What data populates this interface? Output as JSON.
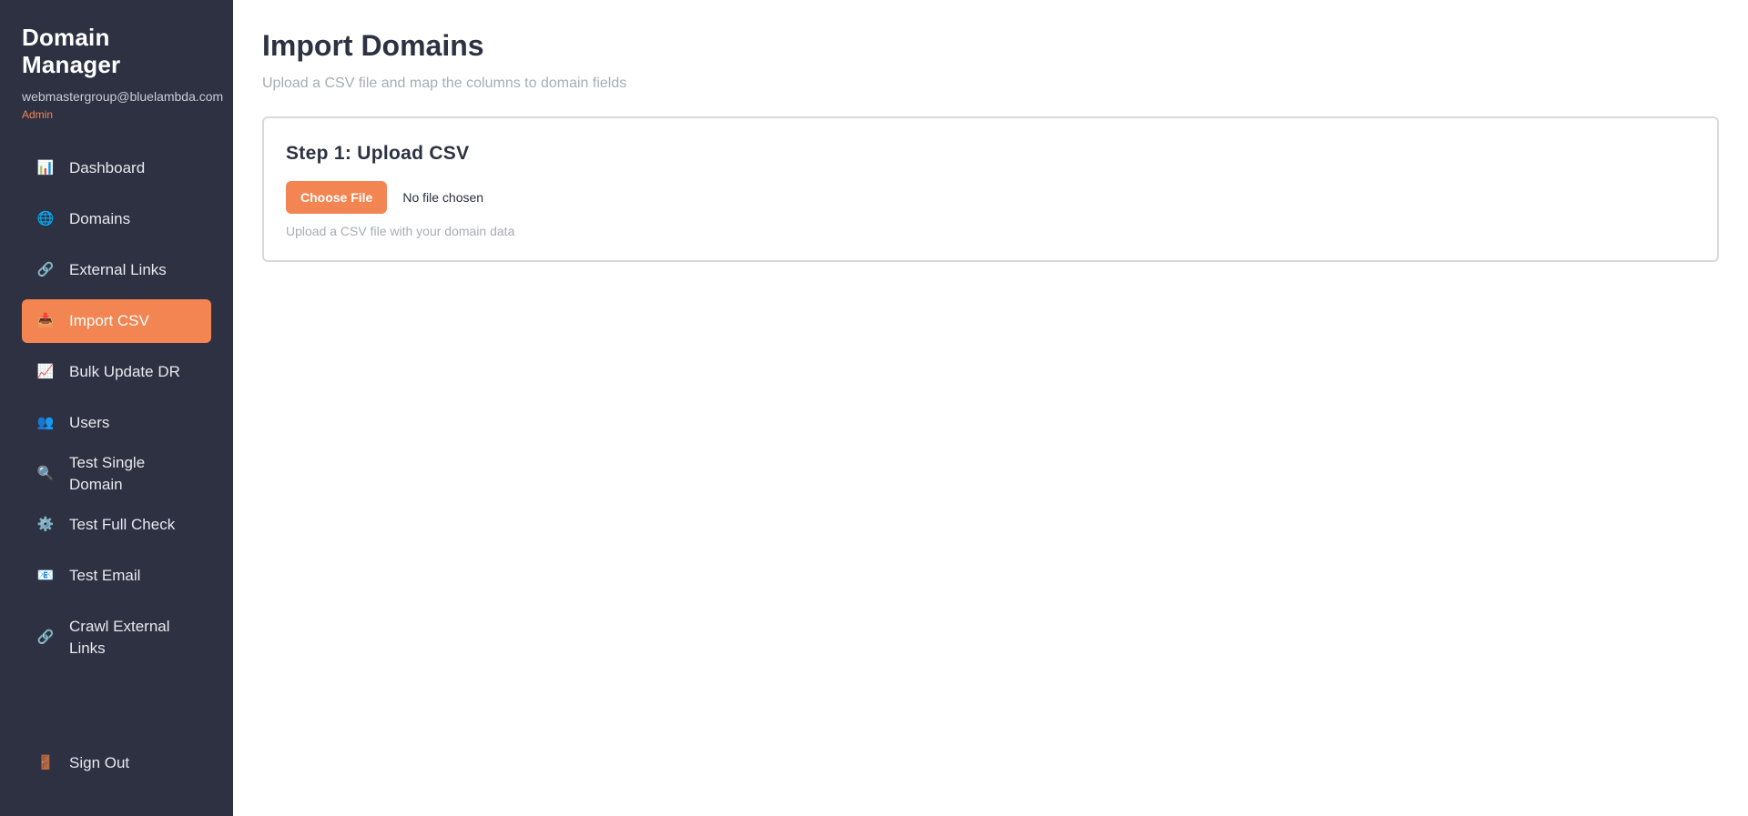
{
  "sidebar": {
    "title": "Domain Manager",
    "email": "webmastergroup@bluelambda.com",
    "role": "Admin",
    "items": [
      {
        "label": "Dashboard",
        "icon": "📊"
      },
      {
        "label": "Domains",
        "icon": "🌐"
      },
      {
        "label": "External Links",
        "icon": "🔗"
      },
      {
        "label": "Import CSV",
        "icon": "📥"
      },
      {
        "label": "Bulk Update DR",
        "icon": "📈"
      },
      {
        "label": "Users",
        "icon": "👥"
      },
      {
        "label": "Test Single Domain",
        "icon": "🔍"
      },
      {
        "label": "Test Full Check",
        "icon": "⚙️"
      },
      {
        "label": "Test Email",
        "icon": "📧"
      },
      {
        "label": "Crawl External Links",
        "icon": "🔗"
      }
    ],
    "signout": {
      "label": "Sign Out",
      "icon": "🚪"
    }
  },
  "main": {
    "title": "Import Domains",
    "subtitle": "Upload a CSV file and map the columns to domain fields",
    "step": {
      "title": "Step 1: Upload CSV",
      "button": "Choose File",
      "file_status": "No file chosen",
      "help": "Upload a CSV file with your domain data"
    }
  },
  "colors": {
    "sidebar_bg": "#2d3142",
    "accent": "#f28552",
    "muted_text": "#a9acb5"
  }
}
